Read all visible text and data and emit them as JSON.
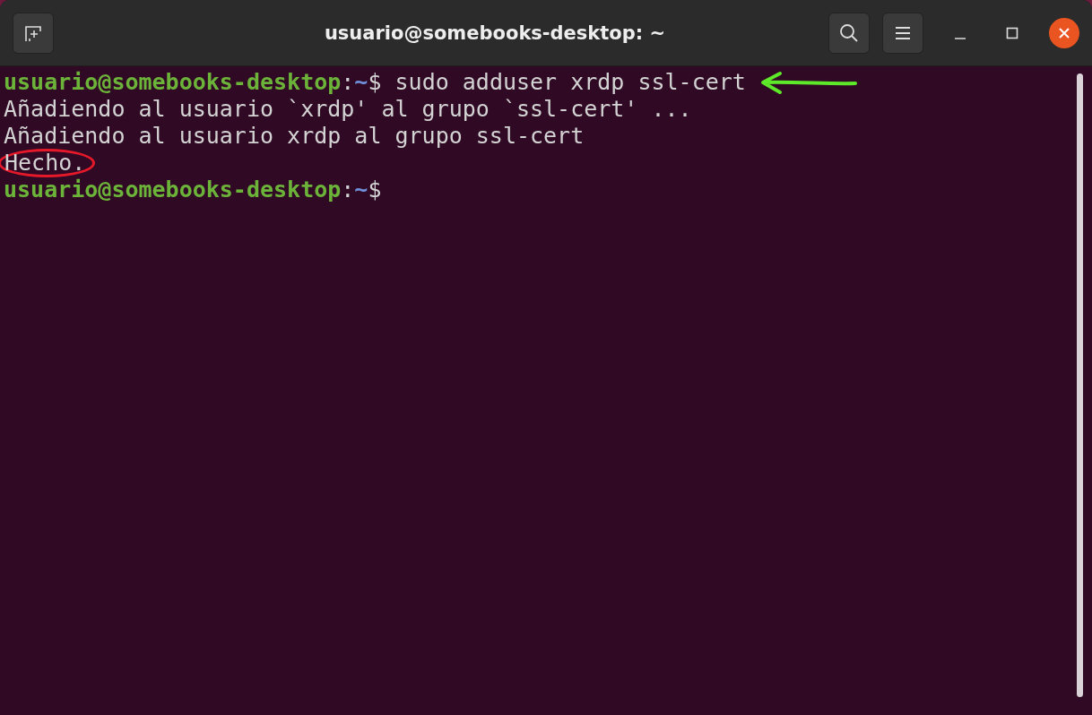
{
  "window": {
    "title": "usuario@somebooks-desktop: ~"
  },
  "terminal": {
    "lines": [
      {
        "kind": "prompt",
        "user": "usuario@somebooks-desktop",
        "separator": ":",
        "path": "~",
        "symbol": "$",
        "command": "sudo adduser xrdp ssl-cert",
        "arrow_marked": true,
        "circled": false
      },
      {
        "kind": "output",
        "text": "Añadiendo al usuario `xrdp' al grupo `ssl-cert' ...",
        "arrow_marked": false,
        "circled": false
      },
      {
        "kind": "output",
        "text": "Añadiendo al usuario xrdp al grupo ssl-cert",
        "arrow_marked": false,
        "circled": false
      },
      {
        "kind": "output",
        "text": "Hecho.",
        "arrow_marked": false,
        "circled": true
      },
      {
        "kind": "prompt",
        "user": "usuario@somebooks-desktop",
        "separator": ":",
        "path": "~",
        "symbol": "$",
        "arrow_marked": false,
        "circled": false
      }
    ]
  }
}
